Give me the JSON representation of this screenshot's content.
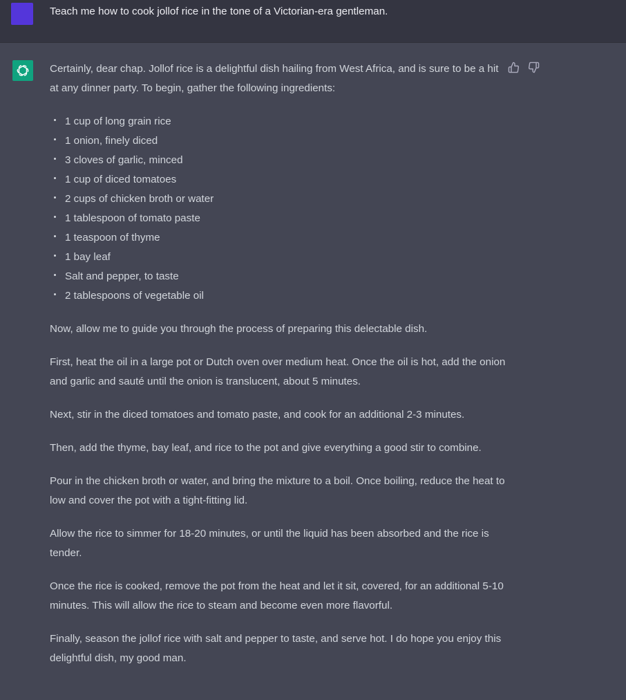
{
  "user_message": {
    "text": "Teach me how to cook jollof rice in the tone of a Victorian-era gentleman.",
    "avatar_color": "#5436DA"
  },
  "assistant_message": {
    "avatar_color": "#10A37F",
    "avatar_icon": "openai-logo-icon",
    "feedback_icons": [
      "thumbs-up-icon",
      "thumbs-down-icon"
    ],
    "intro": "Certainly, dear chap. Jollof rice is a delightful dish hailing from West Africa, and is sure to be a hit at any dinner party. To begin, gather the following ingredients:",
    "ingredients": [
      "1 cup of long grain rice",
      "1 onion, finely diced",
      "3 cloves of garlic, minced",
      "1 cup of diced tomatoes",
      "2 cups of chicken broth or water",
      "1 tablespoon of tomato paste",
      "1 teaspoon of thyme",
      "1 bay leaf",
      "Salt and pepper, to taste",
      "2 tablespoons of vegetable oil"
    ],
    "paragraphs": [
      "Now, allow me to guide you through the process of preparing this delectable dish.",
      "First, heat the oil in a large pot or Dutch oven over medium heat. Once the oil is hot, add the onion and garlic and sauté until the onion is translucent, about 5 minutes.",
      "Next, stir in the diced tomatoes and tomato paste, and cook for an additional 2-3 minutes.",
      "Then, add the thyme, bay leaf, and rice to the pot and give everything a good stir to combine.",
      "Pour in the chicken broth or water, and bring the mixture to a boil. Once boiling, reduce the heat to low and cover the pot with a tight-fitting lid.",
      "Allow the rice to simmer for 18-20 minutes, or until the liquid has been absorbed and the rice is tender.",
      "Once the rice is cooked, remove the pot from the heat and let it sit, covered, for an additional 5-10 minutes. This will allow the rice to steam and become even more flavorful.",
      "Finally, season the jollof rice with salt and pepper to taste, and serve hot. I do hope you enjoy this delightful dish, my good man."
    ]
  }
}
